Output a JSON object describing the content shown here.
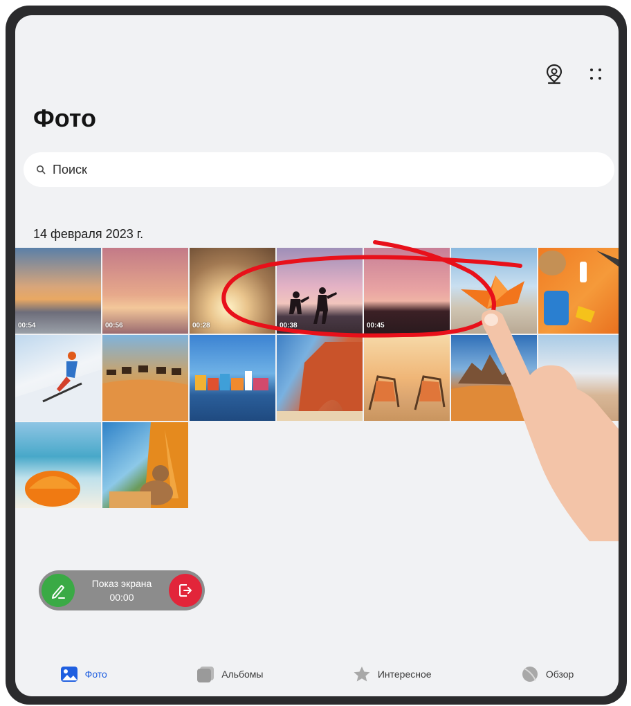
{
  "header": {
    "title": "Фото",
    "icons": [
      "map-pin-person-icon",
      "more-grid-icon"
    ]
  },
  "search": {
    "placeholder": "Поиск"
  },
  "date_group": {
    "label": "14 февраля 2023 г."
  },
  "thumbnails": [
    {
      "kind": "video",
      "duration": "00:54",
      "subject": "sunset sea with clouds"
    },
    {
      "kind": "video",
      "duration": "00:56",
      "subject": "palm tree at sunset"
    },
    {
      "kind": "video",
      "duration": "00:28",
      "subject": "pampas grass sunlight"
    },
    {
      "kind": "video",
      "duration": "00:38",
      "subject": "two people jumping at dusk"
    },
    {
      "kind": "video",
      "duration": "00:45",
      "subject": "pink sunset beach"
    },
    {
      "kind": "photo",
      "subject": "orange paper boat on sand"
    },
    {
      "kind": "photo",
      "subject": "beach accessories on orange background"
    },
    {
      "kind": "photo",
      "subject": "skier in snow"
    },
    {
      "kind": "photo",
      "subject": "camel caravan in desert"
    },
    {
      "kind": "photo",
      "subject": "colorful houses on water"
    },
    {
      "kind": "photo",
      "subject": "red rock arch on beach"
    },
    {
      "kind": "photo",
      "subject": "two deck chairs on beach"
    },
    {
      "kind": "photo",
      "subject": "desert rock formations"
    },
    {
      "kind": "photo",
      "subject": "beach with sunbathers"
    },
    {
      "kind": "photo",
      "subject": "orange beach umbrella"
    },
    {
      "kind": "photo",
      "subject": "teddy bear in orange tent"
    }
  ],
  "screen_share": {
    "title": "Показ экрана",
    "time": "00:00"
  },
  "bottom_nav": [
    {
      "label": "Фото",
      "icon": "photos-icon",
      "active": true
    },
    {
      "label": "Альбомы",
      "icon": "albums-icon",
      "active": false
    },
    {
      "label": "Интересное",
      "icon": "star-icon",
      "active": false
    },
    {
      "label": "Обзор",
      "icon": "discover-icon",
      "active": false
    }
  ],
  "colors": {
    "background": "#f1f2f4",
    "accent": "#1f5fe0",
    "annotation": "#e8101a",
    "share_green": "#3aaa45",
    "share_red": "#e2253a"
  }
}
